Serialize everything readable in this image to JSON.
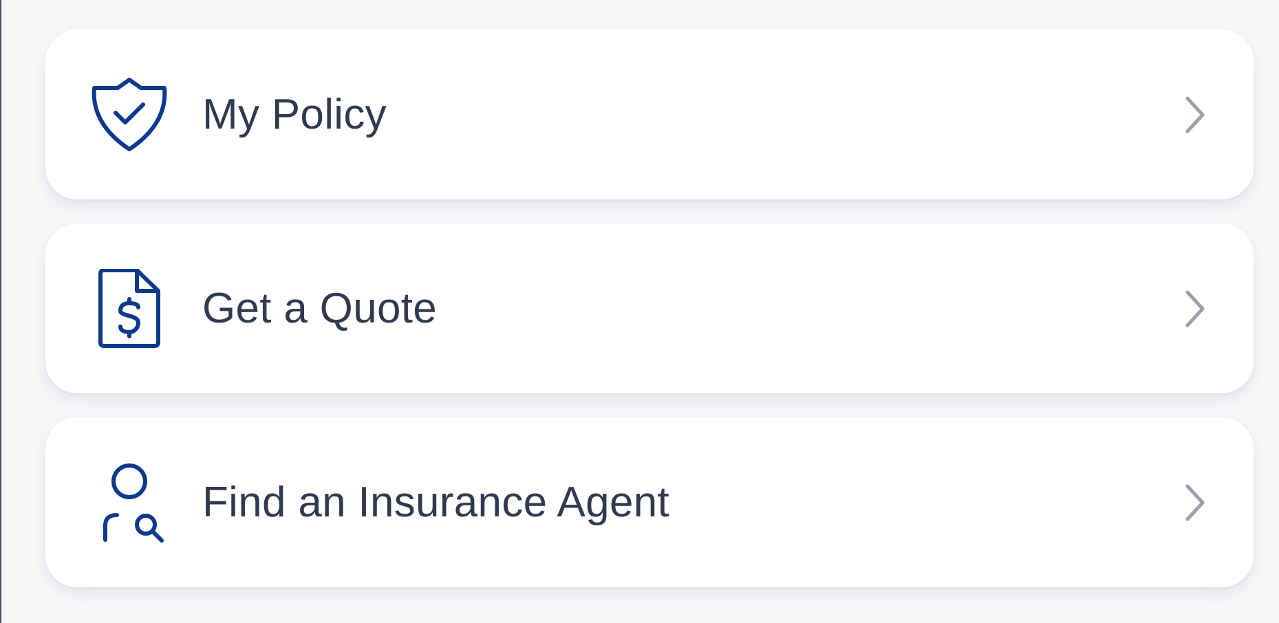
{
  "theme": {
    "icon_color": "#0b3a8d",
    "label_color": "#2f3a4f",
    "chevron_color": "#9aa1ad",
    "background": "#f5f6f8",
    "card_background": "#ffffff"
  },
  "menu": {
    "items": [
      {
        "label": "My Policy",
        "icon": "shield-check-icon",
        "chevron": "chevron-right-icon"
      },
      {
        "label": "Get a Quote",
        "icon": "document-dollar-icon",
        "chevron": "chevron-right-icon"
      },
      {
        "label": "Find an Insurance Agent",
        "icon": "user-search-icon",
        "chevron": "chevron-right-icon"
      }
    ]
  }
}
